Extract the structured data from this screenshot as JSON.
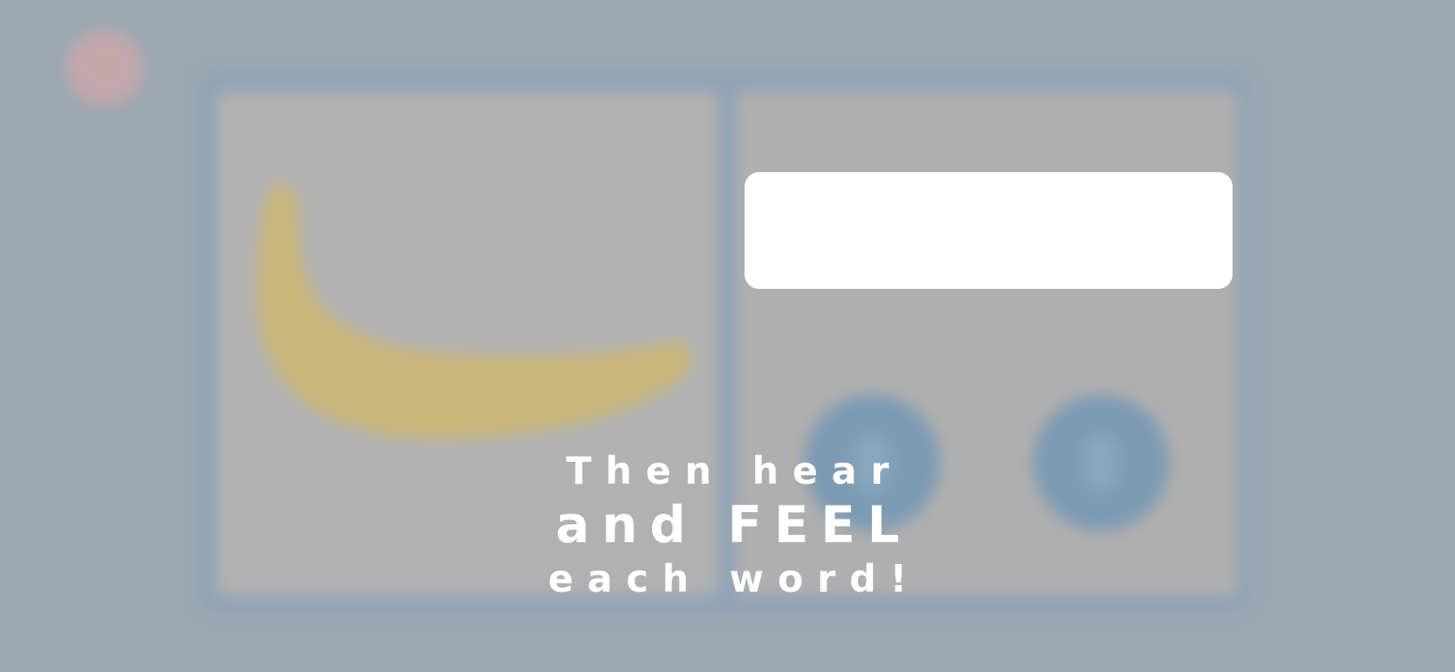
{
  "overlay": {
    "caption_line1": "Then hear",
    "caption_line2": "and FEEL",
    "caption_line3": "each word!"
  },
  "icons": {
    "close": "close-icon",
    "sound_one": "speaker-icon",
    "sound_two": "speaker-icon"
  },
  "colors": {
    "background": "#9ca9b2",
    "card_frame": "#8ea3b6",
    "panel": "#b1b1b1",
    "button": "#7e9bb4",
    "close_button": "#c3a7ab",
    "banana": "#c9b57a",
    "caption": "#ffffff",
    "word_box": "#ffffff"
  }
}
